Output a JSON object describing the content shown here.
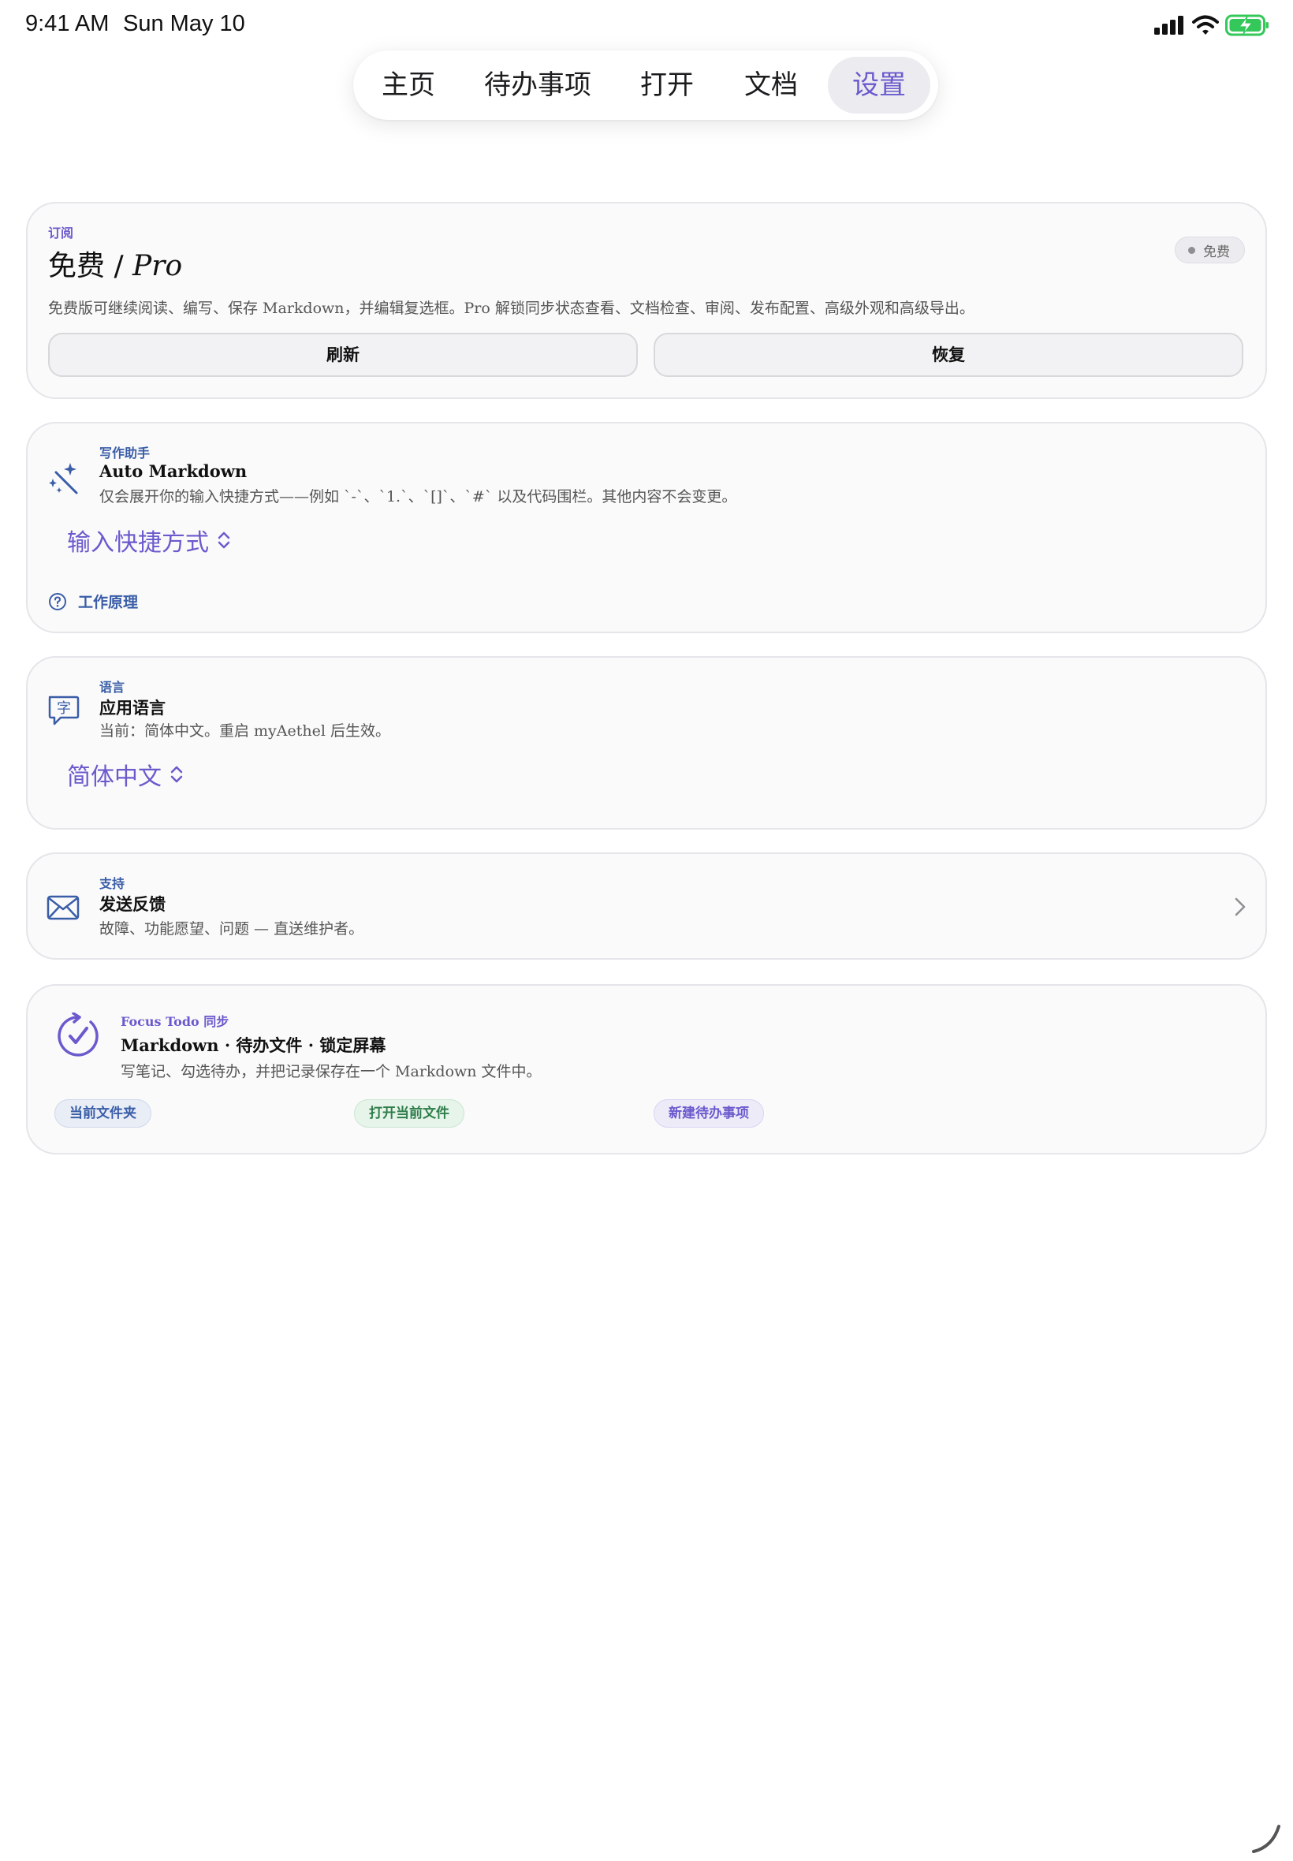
{
  "status_bar": {
    "time": "9:41 AM",
    "date": "Sun May 10"
  },
  "tabs": [
    {
      "label": "主页",
      "active": false
    },
    {
      "label": "待办事项",
      "active": false
    },
    {
      "label": "打开",
      "active": false
    },
    {
      "label": "文档",
      "active": false
    },
    {
      "label": "设置",
      "active": true
    }
  ],
  "subscription": {
    "eyebrow": "订阅",
    "title_main": "免费 / ",
    "title_pro": "Pro",
    "badge": "免费",
    "description": "免费版可继续阅读、编写、保存 Markdown，并编辑复选框。Pro 解锁同步状态查看、文档检查、审阅、发布配置、高级外观和高级导出。",
    "refresh_label": "刷新",
    "restore_label": "恢复"
  },
  "writing_assistant": {
    "eyebrow": "写作助手",
    "title": "Auto Markdown",
    "description": "仅会展开你的输入快捷方式——例如 `-`、`1.`、`[]`、`#` 以及代码围栏。其他内容不会变更。",
    "picker_value": "输入快捷方式",
    "help_link": "工作原理",
    "icon": "magic-wand-icon"
  },
  "language": {
    "eyebrow": "语言",
    "title": "应用语言",
    "description": "当前：简体中文。重启 myAethel 后生效。",
    "picker_value": "简体中文",
    "icon": "translate-bubble-icon"
  },
  "support": {
    "eyebrow": "支持",
    "title": "发送反馈",
    "description": "故障、功能愿望、问题 — 直送维护者。",
    "icon": "envelope-icon"
  },
  "focus_todo": {
    "eyebrow": "Focus Todo 同步",
    "title": "Markdown · 待办文件 · 锁定屏幕",
    "description": "写笔记、勾选待办，并把记录保存在一个 Markdown 文件中。",
    "chips": [
      "当前文件夹",
      "打开当前文件",
      "新建待办事项"
    ],
    "icon": "sync-check-icon"
  },
  "colors": {
    "accent": "#6a5acd",
    "link_blue": "#3a5da8",
    "battery_green": "#34c759"
  }
}
